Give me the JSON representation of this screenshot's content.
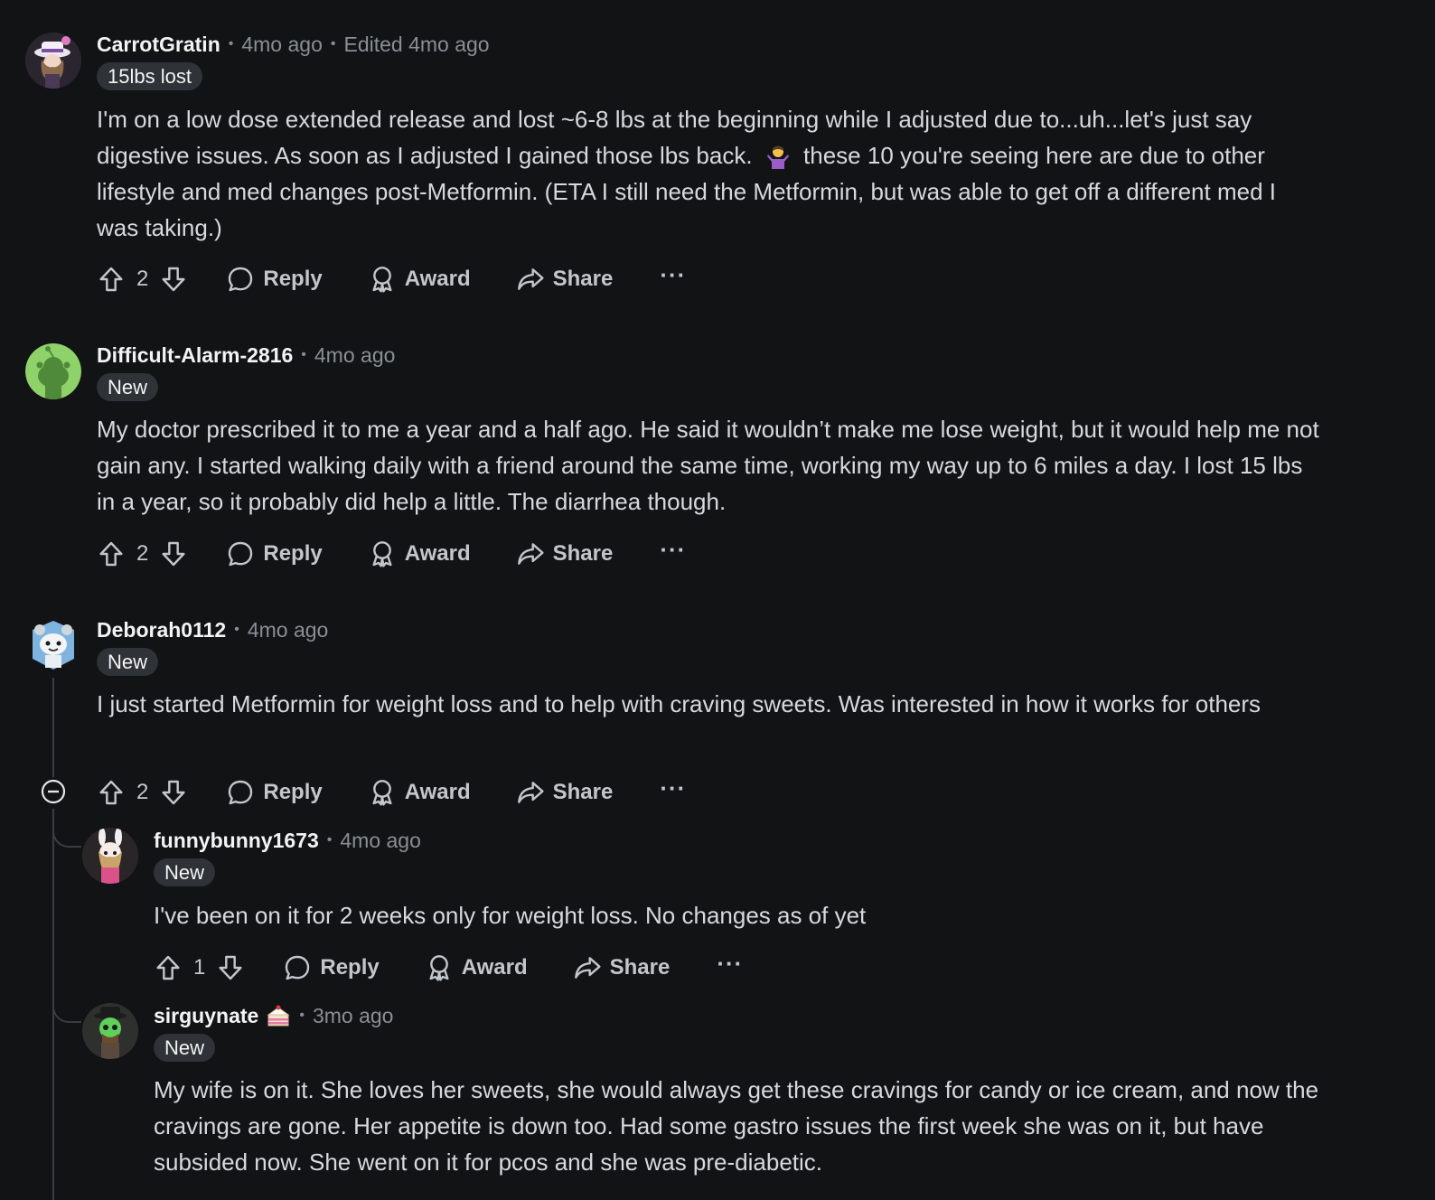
{
  "comments": [
    {
      "author": "CarrotGratin",
      "time": "4mo ago",
      "edited": "Edited 4mo ago",
      "flair": "15lbs lost",
      "body_1": "I'm on a low dose extended release and lost ~6-8 lbs at the beginning while I adjusted due to...uh...let's just say digestive issues. As soon as I adjusted I gained those lbs back.",
      "body_2": "these 10 you're seeing here are due to other lifestyle and med changes post-Metformin. (ETA I still need the Metformin, but was able to get off a different med I was taking.)",
      "score": "2",
      "avatar_color": "#5c4a6b"
    },
    {
      "author": "Difficult-Alarm-2816",
      "time": "4mo ago",
      "flair": "New",
      "body": "My doctor prescribed it to me a year and a half ago. He said it wouldn’t make me lose weight, but it would help me not gain any. I started walking daily with a friend around the same time, working my way up to 6 miles a day. I lost 15 lbs in a year, so it probably did help a little. The diarrhea though.",
      "score": "2",
      "avatar_color": "#8fd26a"
    },
    {
      "author": "Deborah0112",
      "time": "4mo ago",
      "flair": "New",
      "body": "I just started Metformin for weight loss and to help with craving sweets. Was interested in how it works for others",
      "score": "2",
      "avatar_color": "#6aa8d8"
    },
    {
      "author": "funnybunny1673",
      "time": "4mo ago",
      "flair": "New",
      "body": "I've been on it for 2 weeks only for weight loss. No changes as of yet",
      "score": "1",
      "avatar_color": "#e8d6d0"
    },
    {
      "author": "sirguynate",
      "time": "3mo ago",
      "flair": "New",
      "body": "My wife is on it. She loves her sweets, she would always get these cravings for candy or ice cream, and now the cravings are gone. Her appetite is down too. Had some gastro issues the first week she was on it, but have subsided now. She went on it for pcos and she was pre-diabetic.",
      "avatar_color": "#3a3f3a"
    }
  ],
  "actions": {
    "reply": "Reply",
    "award": "Award",
    "share": "Share",
    "more": "···"
  },
  "icons": {
    "upvote": "upvote-icon",
    "downvote": "downvote-icon",
    "reply": "comment-bubble-icon",
    "award": "award-ribbon-icon",
    "share": "share-arrow-icon",
    "collapse": "collapse-minus-icon",
    "cake_day": "cake-icon",
    "shrug_emoji": "person-shrugging-emoji"
  },
  "colors": {
    "background": "#111315",
    "text": "#d7dadc",
    "muted": "#8a8f94",
    "flair_bg": "#2f3236"
  }
}
